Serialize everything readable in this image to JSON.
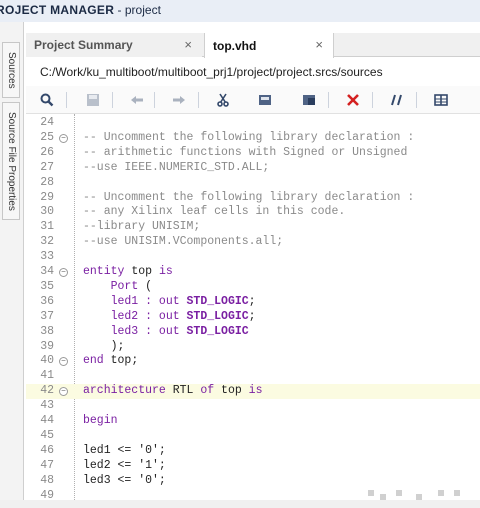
{
  "window": {
    "title_bold": "ROJECT MANAGER",
    "title_rest": " - project"
  },
  "side_tabs": {
    "sources": "Sources",
    "hierarchy": "Source File Properties"
  },
  "tabs": [
    {
      "label": "Project Summary",
      "close": "×"
    },
    {
      "label": "top.vhd",
      "close": "×"
    }
  ],
  "path": "C:/Work/ku_multiboot/multiboot_prj1/project/project.srcs/sources",
  "toolbar_icons": [
    "search-icon",
    "save-icon",
    "undo-icon",
    "redo-icon",
    "cut-icon",
    "copy-icon",
    "paste-icon",
    "delete-icon",
    "comment-icon",
    "columns-icon"
  ],
  "editor": {
    "lines": [
      {
        "n": "24",
        "fold": false,
        "hl": false,
        "parts": []
      },
      {
        "n": "25",
        "fold": true,
        "hl": false,
        "parts": [
          {
            "c": "cm",
            "t": "-- Uncomment the following library declaration :"
          }
        ]
      },
      {
        "n": "26",
        "fold": false,
        "hl": false,
        "parts": [
          {
            "c": "cm",
            "t": "-- arithmetic functions with Signed or Unsigned"
          }
        ]
      },
      {
        "n": "27",
        "fold": false,
        "hl": false,
        "parts": [
          {
            "c": "cm",
            "t": "--use IEEE.NUMERIC_STD.ALL;"
          }
        ]
      },
      {
        "n": "28",
        "fold": false,
        "hl": false,
        "parts": []
      },
      {
        "n": "29",
        "fold": false,
        "hl": false,
        "parts": [
          {
            "c": "cm",
            "t": "-- Uncomment the following library declaration :"
          }
        ]
      },
      {
        "n": "30",
        "fold": false,
        "hl": false,
        "parts": [
          {
            "c": "cm",
            "t": "-- any Xilinx leaf cells in this code."
          }
        ]
      },
      {
        "n": "31",
        "fold": false,
        "hl": false,
        "parts": [
          {
            "c": "cm",
            "t": "--library UNISIM;"
          }
        ]
      },
      {
        "n": "32",
        "fold": false,
        "hl": false,
        "parts": [
          {
            "c": "cm",
            "t": "--use UNISIM.VComponents.all;"
          }
        ]
      },
      {
        "n": "33",
        "fold": false,
        "hl": false,
        "parts": []
      },
      {
        "n": "34",
        "fold": true,
        "hl": false,
        "parts": [
          {
            "c": "kw",
            "t": "entity"
          },
          {
            "c": "tx",
            "t": " top "
          },
          {
            "c": "kw",
            "t": "is"
          }
        ]
      },
      {
        "n": "35",
        "fold": false,
        "hl": false,
        "parts": [
          {
            "c": "tx",
            "t": "    "
          },
          {
            "c": "kw",
            "t": "Port"
          },
          {
            "c": "tx",
            "t": " ("
          }
        ]
      },
      {
        "n": "36",
        "fold": false,
        "hl": false,
        "parts": [
          {
            "c": "kw",
            "t": "    led1 : out "
          },
          {
            "c": "ty",
            "t": "STD_LOGIC"
          },
          {
            "c": "tx",
            "t": ";"
          }
        ]
      },
      {
        "n": "37",
        "fold": false,
        "hl": false,
        "parts": [
          {
            "c": "kw",
            "t": "    led2 : out "
          },
          {
            "c": "ty",
            "t": "STD_LOGIC"
          },
          {
            "c": "tx",
            "t": ";"
          }
        ]
      },
      {
        "n": "38",
        "fold": false,
        "hl": false,
        "parts": [
          {
            "c": "kw",
            "t": "    led3 : out "
          },
          {
            "c": "ty",
            "t": "STD_LOGIC"
          }
        ]
      },
      {
        "n": "39",
        "fold": false,
        "hl": false,
        "parts": [
          {
            "c": "tx",
            "t": "    );"
          }
        ]
      },
      {
        "n": "40",
        "fold": true,
        "hl": false,
        "parts": [
          {
            "c": "kw",
            "t": "end"
          },
          {
            "c": "tx",
            "t": " top;"
          }
        ]
      },
      {
        "n": "41",
        "fold": false,
        "hl": false,
        "parts": []
      },
      {
        "n": "42",
        "fold": true,
        "hl": true,
        "parts": [
          {
            "c": "kw",
            "t": "architecture"
          },
          {
            "c": "tx",
            "t": " RTL "
          },
          {
            "c": "kw",
            "t": "of"
          },
          {
            "c": "tx",
            "t": " top "
          },
          {
            "c": "kw",
            "t": "is"
          }
        ]
      },
      {
        "n": "43",
        "fold": false,
        "hl": false,
        "parts": []
      },
      {
        "n": "44",
        "fold": false,
        "hl": false,
        "parts": [
          {
            "c": "kw",
            "t": "begin"
          }
        ]
      },
      {
        "n": "45",
        "fold": false,
        "hl": false,
        "parts": []
      },
      {
        "n": "46",
        "fold": false,
        "hl": false,
        "parts": [
          {
            "c": "tx",
            "t": "led1 <= '0';"
          }
        ]
      },
      {
        "n": "47",
        "fold": false,
        "hl": false,
        "parts": [
          {
            "c": "tx",
            "t": "led2 <= '1';"
          }
        ]
      },
      {
        "n": "48",
        "fold": false,
        "hl": false,
        "parts": [
          {
            "c": "tx",
            "t": "led3 <= '0';"
          }
        ]
      },
      {
        "n": "49",
        "fold": false,
        "hl": false,
        "parts": []
      }
    ]
  }
}
